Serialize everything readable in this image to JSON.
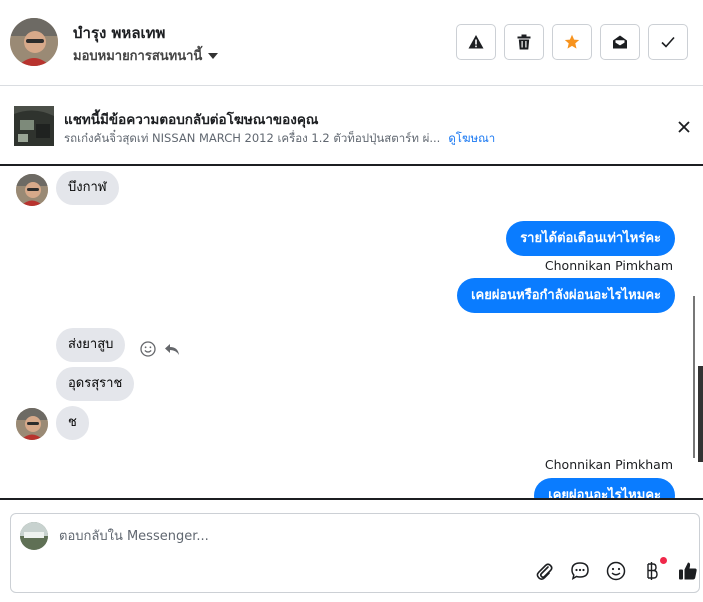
{
  "header": {
    "contact_name": "บำรุง พหลเทพ",
    "assign_label": "มอบหมายการสนทนานี้",
    "actions": [
      "spam-icon",
      "trash-icon",
      "star-icon",
      "mark-unread-icon",
      "check-icon"
    ],
    "star_color": "#f7931e"
  },
  "ad": {
    "title": "แชทนี้มีข้อความตอบกลับต่อโฆษณาของคุณ",
    "subtitle": "รถเก๋งคันจิ๋วสุดเท่ NISSAN MARCH 2012 เครื่อง 1.2 ตัวท็อปปุ่นสตาร์ท ผ่...",
    "link": "ดูโฆษณา"
  },
  "messages": {
    "m1": "บึงกาฬ",
    "m2": "รายได้ต่อเดือนเท่าไหร่คะ",
    "sender1": "Chonnikan Pimkham",
    "m3": "เคยผ่อนหรือกำลังผ่อนอะไรไหมคะ",
    "m4": "ส่งยาสูบ",
    "m5": "อุดรสุราช",
    "m6": "ช",
    "sender2": "Chonnikan Pimkham",
    "m7": "เคยผ่อนอะไรไหมคะ"
  },
  "composer": {
    "placeholder": "ตอบกลับใน Messenger..."
  },
  "colors": {
    "outgoing_bubble": "#0a7cff",
    "incoming_bubble": "#e4e6eb",
    "link": "#1877f2",
    "notification_dot": "#f0284a"
  }
}
